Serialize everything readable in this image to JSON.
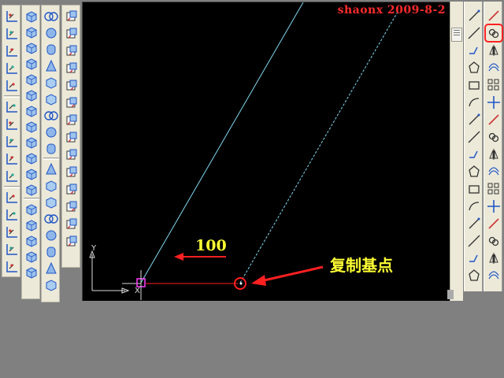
{
  "watermark": "shaonx 2009-8-2",
  "drawing": {
    "dimension_value": "100",
    "callout_label": "复制基点",
    "ucs_y_label": "Y",
    "ucs_x_label": "X"
  },
  "colors": {
    "canvas_bg": "#000000",
    "toolbar_bg": "#ece9d8",
    "callout_red": "#ff2020",
    "annotation_yellow": "#ffff33",
    "line_cyan": "#7fd8f0",
    "grip_magenta": "#ff40ff"
  },
  "toolbars": {
    "left_col1": [
      "ucs-icon",
      "ucs-world-icon",
      "ucs-previous-icon",
      "ucs-face-icon",
      "ucs-object-icon",
      "ucs-view-icon",
      "ucs-origin-icon",
      "ucs-zaxis-icon",
      "ucs-3point-icon",
      "ucs-x-icon",
      "ucs-y-icon",
      "ucs-z-icon",
      "ucs-apply-icon",
      "named-ucs-icon",
      "ucs-ortho-icon"
    ],
    "left_col2": [
      "box-surface-icon",
      "wedge-surface-icon",
      "pyramid-icon",
      "cone-surface-icon",
      "sphere-surface-icon",
      "dome-icon",
      "dish-icon",
      "torus-surface-icon",
      "mesh-3d-icon",
      "revolved-surface-icon",
      "tabulated-surface-icon",
      "ruled-surface-icon",
      "edge-surface-icon",
      "3dface-icon",
      "edge-icon",
      "region-icon",
      "boolean-icon"
    ],
    "left_col3": [
      "union-icon",
      "subtract-icon",
      "intersect-icon",
      "box-icon",
      "sphere-icon",
      "cylinder-icon",
      "cone-icon",
      "wedge-icon",
      "torus-icon",
      "extrude-icon",
      "revolve-icon",
      "slice-icon",
      "section-icon",
      "interfere-icon",
      "setup-drawing-icon",
      "setup-view-icon",
      "setup-profile-icon"
    ],
    "right_draw": [
      "line-icon",
      "construction-line-icon",
      "polyline-icon",
      "polygon-icon",
      "rectangle-icon",
      "arc-icon",
      "circle-icon",
      "revision-cloud-icon",
      "spline-icon",
      "ellipse-icon",
      "ellipse-arc-icon",
      "insert-block-icon",
      "make-block-icon",
      "point-icon",
      "hatch-icon",
      "region-icon"
    ],
    "right_modify": [
      "erase-icon",
      "copy-icon",
      "mirror-icon",
      "offset-icon",
      "array-icon",
      "move-icon",
      "rotate-icon",
      "scale-icon",
      "stretch-icon",
      "trim-icon",
      "extend-icon",
      "break-icon",
      "join-icon",
      "chamfer-icon",
      "fillet-icon",
      "explode-icon"
    ]
  },
  "highlighted_tool": "copy-icon"
}
